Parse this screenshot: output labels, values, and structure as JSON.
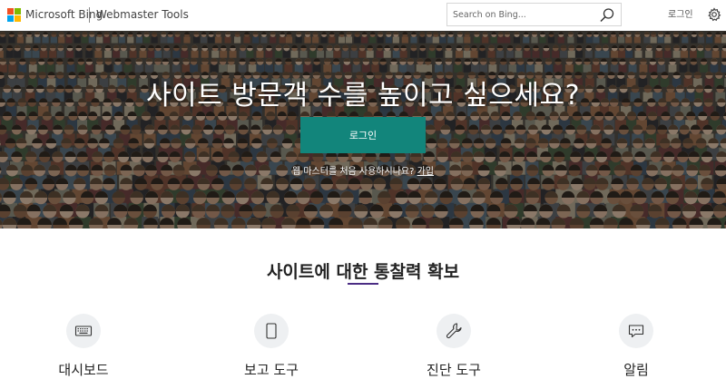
{
  "header": {
    "brand": "Microsoft Bing",
    "product": "Webmaster Tools",
    "search_placeholder": "Search on Bing...",
    "login_label": "로그인",
    "logo_colors": [
      "#f25022",
      "#7fba00",
      "#00a4ef",
      "#ffb900"
    ]
  },
  "hero": {
    "title": "사이트 방문객 수를 높이고 싶으세요?",
    "login_button": "로그인",
    "new_user_text": "웹 마스터를 처음 사용하시나요?",
    "signup_link": "가입",
    "button_color": "#12857b"
  },
  "features": {
    "title": "사이트에 대한 통찰력 확보",
    "underline_color": "#4b2d84",
    "items": [
      {
        "label": "대시보드",
        "icon": "keyboard-icon"
      },
      {
        "label": "보고 도구",
        "icon": "tablet-icon"
      },
      {
        "label": "진단 도구",
        "icon": "wrench-icon"
      },
      {
        "label": "알림",
        "icon": "message-icon"
      }
    ]
  }
}
